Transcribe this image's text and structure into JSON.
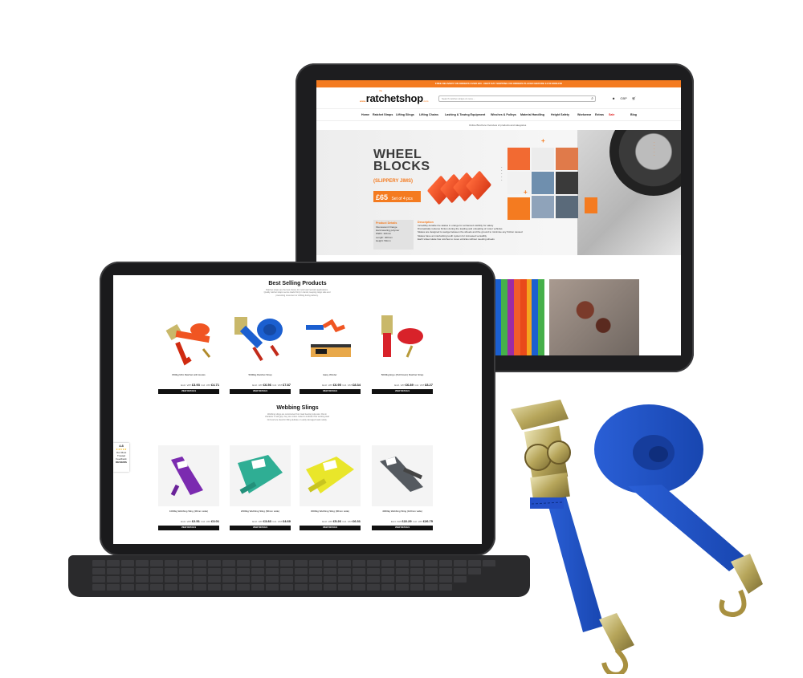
{
  "back_screen": {
    "promo_text": "FREE DELIVERY ON ORDERS OVER £60 · NEXT DAY SHIPPING ON ORDERS PLACED BEFORE 14:00 MON-FRI",
    "logo": {
      "prefix": "www.",
      "small_word": "the",
      "brand": "ratchetshop",
      "suffix": ".com"
    },
    "search_placeholder": "Search ratchet straps & more...",
    "currency": "GBP",
    "nav": [
      "Home",
      "Ratchet Straps",
      "Lifting Slings",
      "Lifting Chains",
      "Lashing & Towing Equipment",
      "Winches & Pulleys",
      "Material Handling",
      "Height Safety",
      "Workwear",
      "Extras",
      "Sale",
      "Blog"
    ],
    "breadcrumb": "Online Brochure   Overview of products and categories",
    "hero": {
      "title_line1": "WHEEL",
      "title_line2": "BLOCKS",
      "subtitle": "(SLIPPERY JIMS)",
      "price": "£65",
      "price_note": "Set of 4 pcs",
      "features_title": "Product Details",
      "features": [
        "Fluorescent Orange",
        "Hard wearing polymer",
        "Width: 110mm",
        "Length: 400mm",
        "Height: 50mm"
      ],
      "description_title": "Description",
      "description": [
        "Incredibly durable tire skates in orange for enhanced visibility for safety",
        "Dramatically reduces friction during the loading and unloading of motor vehicles",
        "Skates are designed to wedge between the wheels and the ground to minimise any friction caused",
        "Skates have an interlocking tooth system for increased versatility",
        "Each wheel skate has notches to move vehicles without needing wheels"
      ]
    },
    "accent_color": "#f47b20"
  },
  "front_screen": {
    "best_selling": {
      "title": "Best Selling Products",
      "intro": "Ratchet straps are the best choice for most load restraint applications. Quality ratchet straps secure loads firmly in transit, keeping cargo safe and preventing movement or shifting during delivery.",
      "products": [
        {
          "name": "800kg Mini Ratchet with Hooks",
          "ex_label": "Excl. VAT",
          "ex_price": "£3.93",
          "inc_label": "Incl. VAT",
          "inc_price": "£4.71",
          "button": "VIEW DETAILS"
        },
        {
          "name": "5000kg Ratchet Strap",
          "ex_label": "Excl. VAT",
          "ex_price": "£6.56",
          "inc_label": "Incl. VAT",
          "inc_price": "£7.87",
          "button": "VIEW DETAILS"
        },
        {
          "name": "Easy Winder",
          "ex_label": "Excl. VAT",
          "ex_price": "£6.95",
          "inc_label": "Incl. VAT",
          "inc_price": "£8.34",
          "button": "VIEW DETAILS"
        },
        {
          "name": "5000kg Ergo (Pull Down) Ratchet Strap",
          "ex_label": "Excl. VAT",
          "ex_price": "£6.89",
          "inc_label": "Incl. VAT",
          "inc_price": "£8.27",
          "button": "VIEW DETAILS"
        }
      ]
    },
    "webbing_slings": {
      "title": "Webbing Slings",
      "intro": "Webbing slings are constructed from load bearing polyester. Flat in character to aid grip, they are colour coded to indicate their working load limit and are ideal for lifting delicate or easily damaged loads safely.",
      "products": [
        {
          "name": "1000kg Webbing Sling (30mm wide)",
          "ex_label": "Excl. VAT",
          "ex_price": "£2.51",
          "inc_label": "Incl. VAT",
          "inc_price": "£3.01",
          "button": "VIEW DETAILS"
        },
        {
          "name": "2000kg Webbing Sling (60mm wide)",
          "ex_label": "Excl. VAT",
          "ex_price": "£3.83",
          "inc_label": "Incl. VAT",
          "inc_price": "£4.60",
          "button": "VIEW DETAILS"
        },
        {
          "name": "3000kg Webbing Sling (90mm wide)",
          "ex_label": "Excl. VAT",
          "ex_price": "£5.26",
          "inc_label": "Incl. VAT",
          "inc_price": "£6.31",
          "button": "VIEW DETAILS"
        },
        {
          "name": "4000kg Webbing Sling (120mm wide)",
          "ex_label": "Excl. VAT",
          "ex_price": "£22.29",
          "inc_label": "Incl. VAT",
          "inc_price": "£26.75",
          "button": "VIEW DETAILS"
        }
      ]
    },
    "rating_widget": {
      "score": "4.8",
      "stars": "★★★★★",
      "line1": "Our Most",
      "line2": "Trusted",
      "line3": "Feedback",
      "brand": "REVIEWS"
    }
  }
}
